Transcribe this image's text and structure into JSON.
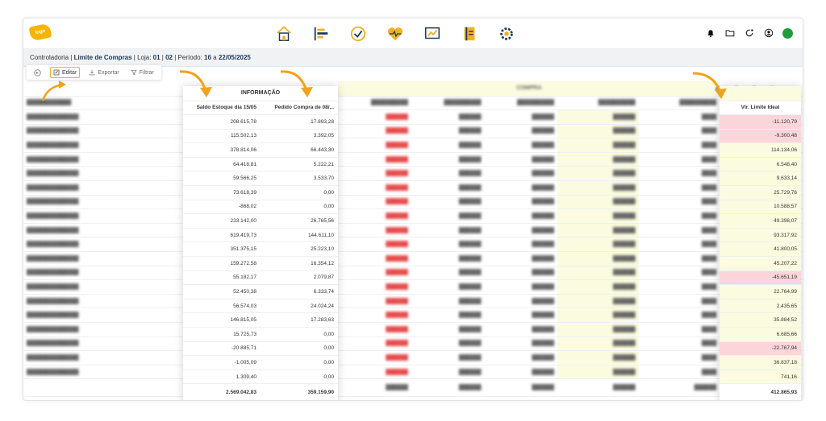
{
  "breadcrumb": {
    "module": "Controladoria",
    "sep1": " | ",
    "screen": "Limite de Compras",
    "loja_label": " | Loja: ",
    "loja1": "01",
    "loja_sep": " | ",
    "loja2": "02",
    "periodo_label": " | Período: ",
    "periodo_start": "16",
    "periodo_mid": " a ",
    "periodo_end": "22/05/2025"
  },
  "toolbar": {
    "edit_label": "Editar",
    "export_label": "Exportar",
    "filter_label": "Filtrar"
  },
  "info_group": {
    "title": "INFORMAÇÃO",
    "col1": "Saldo Estoque dia 15/05",
    "col2": "Pedido Compra de 08/..."
  },
  "compra_group": {
    "title": "COMPRA"
  },
  "ideal_col": {
    "title": "Vlr. Limite Ideal"
  },
  "rows": [
    {
      "saldo": "208.615,78",
      "pedido": "17.893,28",
      "ideal": "-11.120,79",
      "neg": true
    },
    {
      "saldo": "115.502,13",
      "pedido": "3.392,05",
      "ideal": "-9.300,48",
      "neg": true
    },
    {
      "saldo": "378.814,06",
      "pedido": "66.443,30",
      "ideal": "114.134,06",
      "neg": false
    },
    {
      "saldo": "64.418,81",
      "pedido": "5.222,21",
      "ideal": "6.548,40",
      "neg": false
    },
    {
      "saldo": "59.566,25",
      "pedido": "3.533,70",
      "ideal": "9.633,14",
      "neg": false
    },
    {
      "saldo": "73.618,39",
      "pedido": "0,00",
      "ideal": "25.729,76",
      "neg": false
    },
    {
      "saldo": "-868,02",
      "pedido": "0,00",
      "ideal": "10.588,57",
      "neg": false
    },
    {
      "saldo": "233.142,00",
      "pedido": "26.765,56",
      "ideal": "49.398,07",
      "neg": false
    },
    {
      "saldo": "619.419,73",
      "pedido": "144.611,10",
      "ideal": "93.317,92",
      "neg": false
    },
    {
      "saldo": "351.375,15",
      "pedido": "25.223,10",
      "ideal": "41.800,05",
      "neg": false
    },
    {
      "saldo": "159.272,58",
      "pedido": "16.354,12",
      "ideal": "45.207,22",
      "neg": false
    },
    {
      "saldo": "55.182,17",
      "pedido": "2.079,87",
      "ideal": "-45.651,19",
      "neg": true
    },
    {
      "saldo": "52.450,38",
      "pedido": "6.333,74",
      "ideal": "22.764,99",
      "neg": false
    },
    {
      "saldo": "56.574,03",
      "pedido": "24.024,24",
      "ideal": "2.435,65",
      "neg": false
    },
    {
      "saldo": "146.815,05",
      "pedido": "17.283,63",
      "ideal": "35.884,52",
      "neg": false
    },
    {
      "saldo": "15.725,73",
      "pedido": "0,00",
      "ideal": "6.685,66",
      "neg": false
    },
    {
      "saldo": "-20.885,71",
      "pedido": "0,00",
      "ideal": "-22.767,94",
      "neg": true
    },
    {
      "saldo": "-1.005,09",
      "pedido": "0,00",
      "ideal": "36.837,18",
      "neg": false
    },
    {
      "saldo": "1.309,40",
      "pedido": "0,00",
      "ideal": "741,16",
      "neg": false
    }
  ],
  "totals": {
    "saldo": "2.569.042,83",
    "pedido": "359.159,90",
    "ideal": "412.865,93"
  }
}
